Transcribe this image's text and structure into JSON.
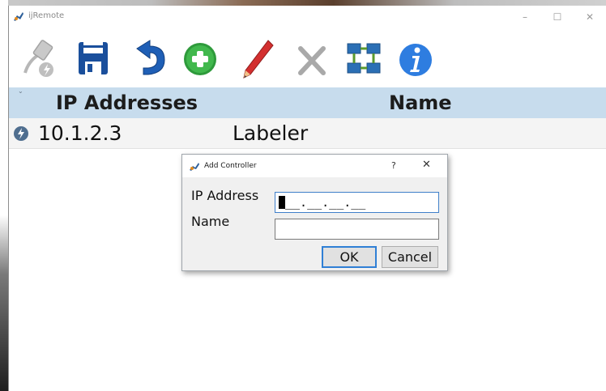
{
  "window": {
    "title": "ijRemote",
    "controls": [
      "minimize-icon",
      "maximize-icon",
      "close-icon"
    ]
  },
  "toolbar": {
    "items": [
      {
        "name": "connect",
        "icon": "ethernet-plug-icon",
        "enabled": false
      },
      {
        "name": "save",
        "icon": "floppy-disk-icon",
        "enabled": true
      },
      {
        "name": "undo",
        "icon": "undo-arrow-icon",
        "enabled": true
      },
      {
        "name": "add",
        "icon": "plus-circle-icon",
        "enabled": true
      },
      {
        "name": "edit",
        "icon": "pencil-icon",
        "enabled": true
      },
      {
        "name": "delete",
        "icon": "x-icon",
        "enabled": false
      },
      {
        "name": "network",
        "icon": "network-icon",
        "enabled": true
      },
      {
        "name": "info",
        "icon": "info-icon",
        "enabled": true
      }
    ]
  },
  "table": {
    "columns": [
      "IP Addresses",
      "Name"
    ],
    "rows": [
      {
        "ip": "10.1.2.3",
        "name": "Labeler",
        "icon": "lightning-bolt-icon"
      }
    ]
  },
  "dialog": {
    "title": "Add Controller",
    "help": "?",
    "close": "✕",
    "ip_label": "IP Address",
    "ip_value": "__.__.__.__",
    "name_label": "Name",
    "name_value": "",
    "ok": "OK",
    "cancel": "Cancel"
  },
  "colors": {
    "header_bg": "#c7dced",
    "row_bg": "#f4f4f4",
    "dialog_bg": "#f0f0f0",
    "accent": "#2f7fd5"
  }
}
